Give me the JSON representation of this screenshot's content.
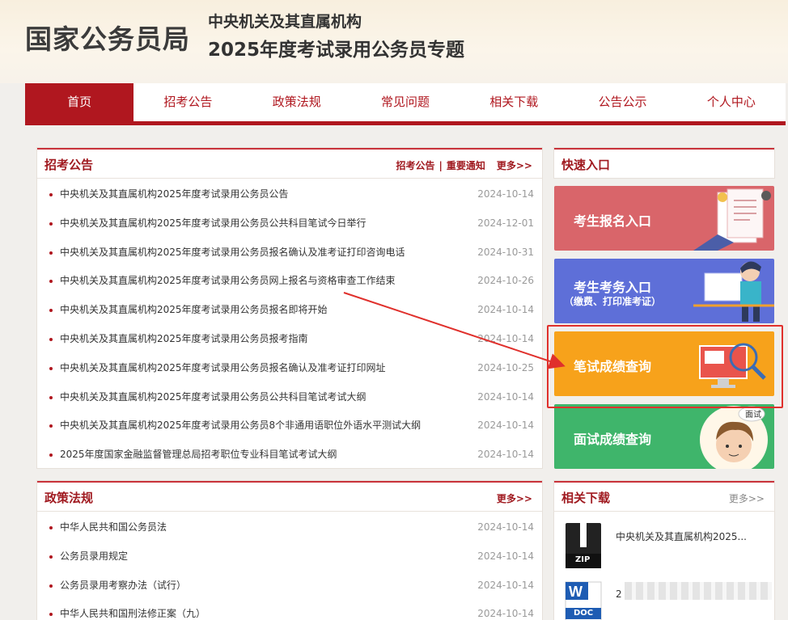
{
  "header": {
    "brand": "国家公务员局",
    "subtitle1": "中央机关及其直属机构",
    "subtitle2": "2025年度考试录用公务员专题"
  },
  "nav": [
    "首页",
    "招考公告",
    "政策法规",
    "常见问题",
    "相关下载",
    "公告公示",
    "个人中心"
  ],
  "recruit": {
    "title": "招考公告",
    "link1": "招考公告",
    "separator": "|",
    "link2": "重要通知",
    "more": "更多>>",
    "items": [
      {
        "text": "中央机关及其直属机构2025年度考试录用公务员公告",
        "date": "2024-10-14"
      },
      {
        "text": "中央机关及其直属机构2025年度考试录用公务员公共科目笔试今日举行",
        "date": "2024-12-01"
      },
      {
        "text": "中央机关及其直属机构2025年度考试录用公务员报名确认及准考证打印咨询电话",
        "date": "2024-10-31"
      },
      {
        "text": "中央机关及其直属机构2025年度考试录用公务员网上报名与资格审查工作结束",
        "date": "2024-10-26"
      },
      {
        "text": "中央机关及其直属机构2025年度考试录用公务员报名即将开始",
        "date": "2024-10-14"
      },
      {
        "text": "中央机关及其直属机构2025年度考试录用公务员报考指南",
        "date": "2024-10-14"
      },
      {
        "text": "中央机关及其直属机构2025年度考试录用公务员报名确认及准考证打印网址",
        "date": "2024-10-25"
      },
      {
        "text": "中央机关及其直属机构2025年度考试录用公务员公共科目笔试考试大纲",
        "date": "2024-10-14"
      },
      {
        "text": "中央机关及其直属机构2025年度考试录用公务员8个非通用语职位外语水平测试大纲",
        "date": "2024-10-14"
      },
      {
        "text": "2025年度国家金融监督管理总局招考职位专业科目笔试考试大纲",
        "date": "2024-10-14"
      }
    ]
  },
  "policy": {
    "title": "政策法规",
    "more": "更多>>",
    "items": [
      {
        "text": "中华人民共和国公务员法",
        "date": "2024-10-14"
      },
      {
        "text": "公务员录用规定",
        "date": "2024-10-14"
      },
      {
        "text": "公务员录用考察办法（试行）",
        "date": "2024-10-14"
      },
      {
        "text": "中华人民共和国刑法修正案（九）",
        "date": "2024-10-14"
      }
    ]
  },
  "quick": {
    "title": "快速入口",
    "cards": [
      {
        "label": "考生报名入口",
        "color": "#d9656a"
      },
      {
        "label": "考生考务入口",
        "sublabel": "（缴费、打印准考证）",
        "color": "#5e6fd8"
      },
      {
        "label": "笔试成绩查询",
        "color": "#f7a21b"
      },
      {
        "label": "面试成绩查询",
        "color": "#3fb56b",
        "badge": "面试"
      }
    ]
  },
  "downloads": {
    "title": "相关下载",
    "more": "更多>>",
    "items": [
      {
        "text": "中央机关及其直属机构2025...",
        "type": "ZIP"
      },
      {
        "text": "2",
        "type": "DOC"
      }
    ]
  },
  "colors": {
    "accent": "#b0171f",
    "highlight": "#e0302c"
  }
}
